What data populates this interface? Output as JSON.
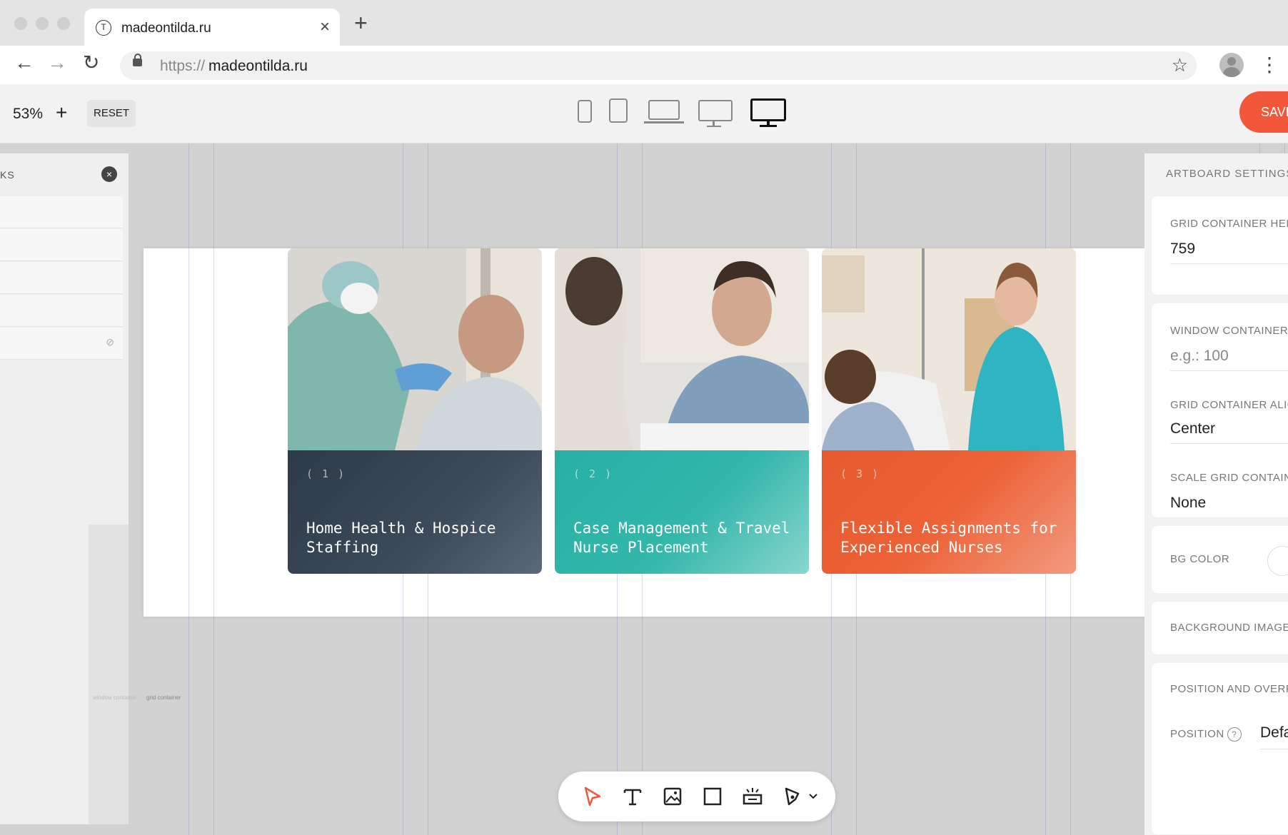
{
  "browser": {
    "tab_title": "madeontilda.ru",
    "tab_close": "×",
    "new_tab": "+",
    "url_scheme": "https://",
    "url_host": "madeontilda.ru",
    "back_icon": "←",
    "forward_icon": "→",
    "reload_icon": "↻",
    "star_icon": "☆",
    "menu_icon": "⋮"
  },
  "toolbar": {
    "zoom": "53%",
    "zoom_plus": "+",
    "reset_label": "RESET",
    "save_label": "SAVE",
    "devices": [
      "phone-portrait",
      "tablet-portrait",
      "laptop",
      "desktop",
      "wide-desktop"
    ],
    "active_device": "wide-desktop"
  },
  "left_panel": {
    "title": "KS",
    "close_icon": "×",
    "rows": [
      "",
      "",
      "",
      "",
      ""
    ],
    "hidden_icon": "⊘",
    "labels": [
      "window container",
      "grid container"
    ]
  },
  "cards": [
    {
      "number": "( 1 )",
      "title": "Home Health & Hospice Staffing",
      "color": "#3c4a5a"
    },
    {
      "number": "( 2 )",
      "title": "Case Management & Travel Nurse Placement",
      "color": "#33b7ab"
    },
    {
      "number": "( 3 )",
      "title": "Flexible Assignments for Experienced Nurses",
      "color": "#ec6236"
    }
  ],
  "right_panel": {
    "title": "ARTBOARD SETTINGS",
    "grid_height_label": "GRID CONTAINER HEIGHT",
    "grid_height_value": "759",
    "window_height_label": "WINDOW CONTAINER HEIGHT",
    "window_height_placeholder": "e.g.: 100",
    "grid_align_label": "GRID CONTAINER ALIGN",
    "grid_align_value": "Center",
    "scale_label": "SCALE GRID CONTAINER",
    "scale_value": "None",
    "bg_color_label": "BG COLOR",
    "bg_image_label": "BACKGROUND IMAGE",
    "position_overflow_label": "POSITION AND OVERFLOW",
    "position_label": "POSITION",
    "position_help": "?",
    "position_value": "Default"
  },
  "colors": {
    "accent": "#f2573a",
    "card1": "#3c4a5a",
    "card2": "#33b7ab",
    "card3": "#ec6236"
  },
  "bottom_tools": [
    "pointer-icon",
    "text-icon",
    "image-icon",
    "shape-icon",
    "button-icon",
    "vector-pen-icon"
  ]
}
